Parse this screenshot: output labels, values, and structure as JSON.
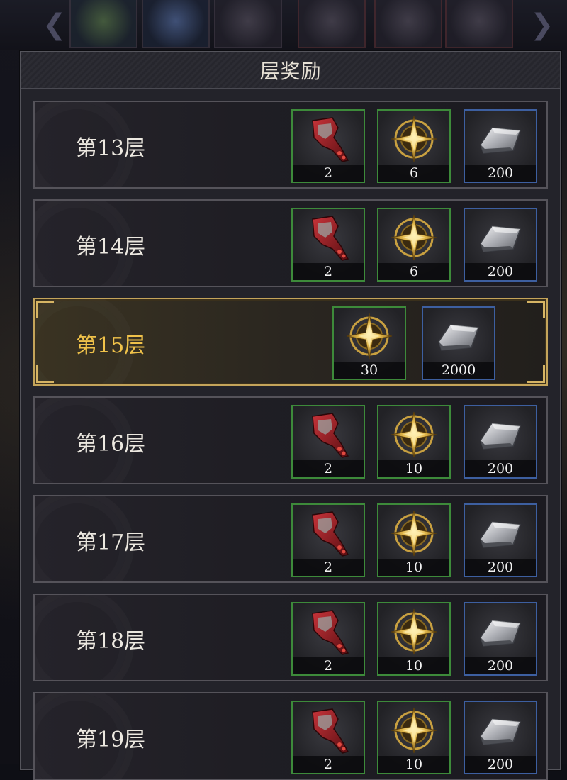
{
  "panel": {
    "title": "层奖励"
  },
  "icons": {
    "shard": "red-cloak-shard-icon",
    "compass": "gold-compass-emblem-icon",
    "ingot": "silver-ingot-icon"
  },
  "colors": {
    "highlight_border": "#c4a45a",
    "highlight_text": "#f0c24a",
    "green_frame": "#3d8a3a",
    "blue_frame": "#3d5fa0"
  },
  "rows": [
    {
      "label": "第13层",
      "rewards": [
        {
          "icon": "shard",
          "qty": "2"
        },
        {
          "icon": "compass",
          "qty": "6"
        },
        {
          "icon": "ingot",
          "qty": "200"
        }
      ]
    },
    {
      "label": "第14层",
      "rewards": [
        {
          "icon": "shard",
          "qty": "2"
        },
        {
          "icon": "compass",
          "qty": "6"
        },
        {
          "icon": "ingot",
          "qty": "200"
        }
      ]
    },
    {
      "label": "第15层",
      "highlight": true,
      "rewards": [
        {
          "icon": "compass",
          "qty": "30"
        },
        {
          "icon": "ingot",
          "qty": "2000"
        }
      ]
    },
    {
      "label": "第16层",
      "rewards": [
        {
          "icon": "shard",
          "qty": "2"
        },
        {
          "icon": "compass",
          "qty": "10"
        },
        {
          "icon": "ingot",
          "qty": "200"
        }
      ]
    },
    {
      "label": "第17层",
      "rewards": [
        {
          "icon": "shard",
          "qty": "2"
        },
        {
          "icon": "compass",
          "qty": "10"
        },
        {
          "icon": "ingot",
          "qty": "200"
        }
      ]
    },
    {
      "label": "第18层",
      "rewards": [
        {
          "icon": "shard",
          "qty": "2"
        },
        {
          "icon": "compass",
          "qty": "10"
        },
        {
          "icon": "ingot",
          "qty": "200"
        }
      ]
    },
    {
      "label": "第19层",
      "rewards": [
        {
          "icon": "shard",
          "qty": "2"
        },
        {
          "icon": "compass",
          "qty": "10"
        },
        {
          "icon": "ingot",
          "qty": "200"
        }
      ]
    }
  ]
}
